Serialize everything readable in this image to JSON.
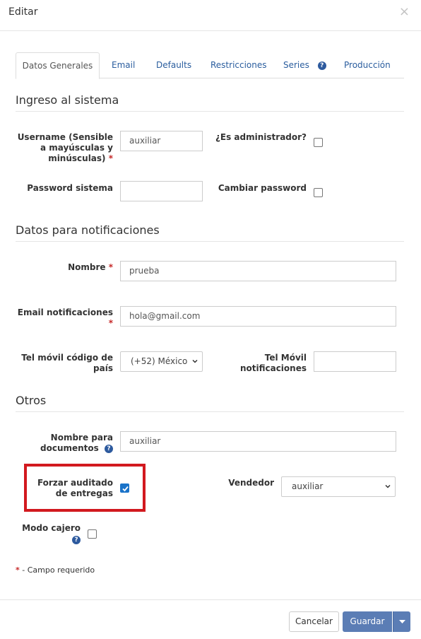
{
  "modal": {
    "title": "Editar",
    "close_glyph": "×"
  },
  "tabs": [
    {
      "label": "Datos Generales",
      "active": true
    },
    {
      "label": "Email"
    },
    {
      "label": "Defaults"
    },
    {
      "label": "Restricciones"
    },
    {
      "label": "Series",
      "icon": "help-icon"
    },
    {
      "label": "Producción"
    }
  ],
  "help_glyph": "?",
  "sections": {
    "ingreso": "Ingreso al sistema",
    "notificaciones": "Datos para notificaciones",
    "otros": "Otros"
  },
  "fields": {
    "username": {
      "label": "Username (Sensible a mayúsculas y minúsculas)",
      "value": "auxiliar",
      "required": true
    },
    "es_admin": {
      "label": "¿Es administrador?",
      "checked": false
    },
    "password": {
      "label": "Password sistema",
      "value": ""
    },
    "cambiar_password": {
      "label": "Cambiar password",
      "checked": false
    },
    "nombre": {
      "label": "Nombre",
      "value": "prueba",
      "required": true
    },
    "email": {
      "label": "Email notificaciones",
      "value": "hola@gmail.com",
      "required": true
    },
    "tel_codigo": {
      "label": "Tel móvil código de país",
      "selected": "(+52) México"
    },
    "tel_movil": {
      "label": "Tel Móvil notificaciones",
      "value": ""
    },
    "nombre_documentos": {
      "label": "Nombre para documentos",
      "value": "auxiliar"
    },
    "forzar_auditado": {
      "label": "Forzar auditado de entregas",
      "checked": true
    },
    "vendedor": {
      "label": "Vendedor",
      "selected": "auxiliar"
    },
    "modo_cajero": {
      "label": "Modo cajero",
      "checked": false
    }
  },
  "required_marker": "*",
  "footnote": {
    "marker": "*",
    "text": "- Campo requerido"
  },
  "buttons": {
    "cancel": "Cancelar",
    "save": "Guardar"
  },
  "colors": {
    "primary": "#5b7db5",
    "link": "#2a5d9e",
    "required": "#c62828",
    "highlight": "#d2191f",
    "checkbox_checked": "#1a73c9"
  }
}
